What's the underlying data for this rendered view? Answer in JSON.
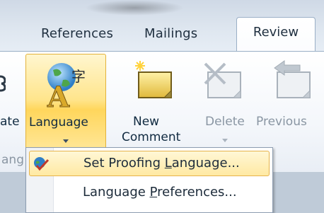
{
  "tabs": {
    "references": "References",
    "mailings": "Mailings",
    "review": "Review"
  },
  "ribbon": {
    "partial_left_label": "ate",
    "language_label": "Language",
    "new_comment_line1": "New",
    "new_comment_line2": "Comment",
    "delete_label": "Delete",
    "previous_label": "Previous",
    "group_partial_label": "ang"
  },
  "dropdown": {
    "item1_prefix": "Set Proofing ",
    "item1_underlined": "L",
    "item1_suffix": "anguage...",
    "item2_prefix": "Language ",
    "item2_underlined": "P",
    "item2_suffix": "references..."
  },
  "colors": {
    "highlight_border": "#e3b23a",
    "highlight_fill": "#ffe58c",
    "ribbon_bg": "#f4f7fb",
    "disabled_text": "#8a96a3"
  }
}
